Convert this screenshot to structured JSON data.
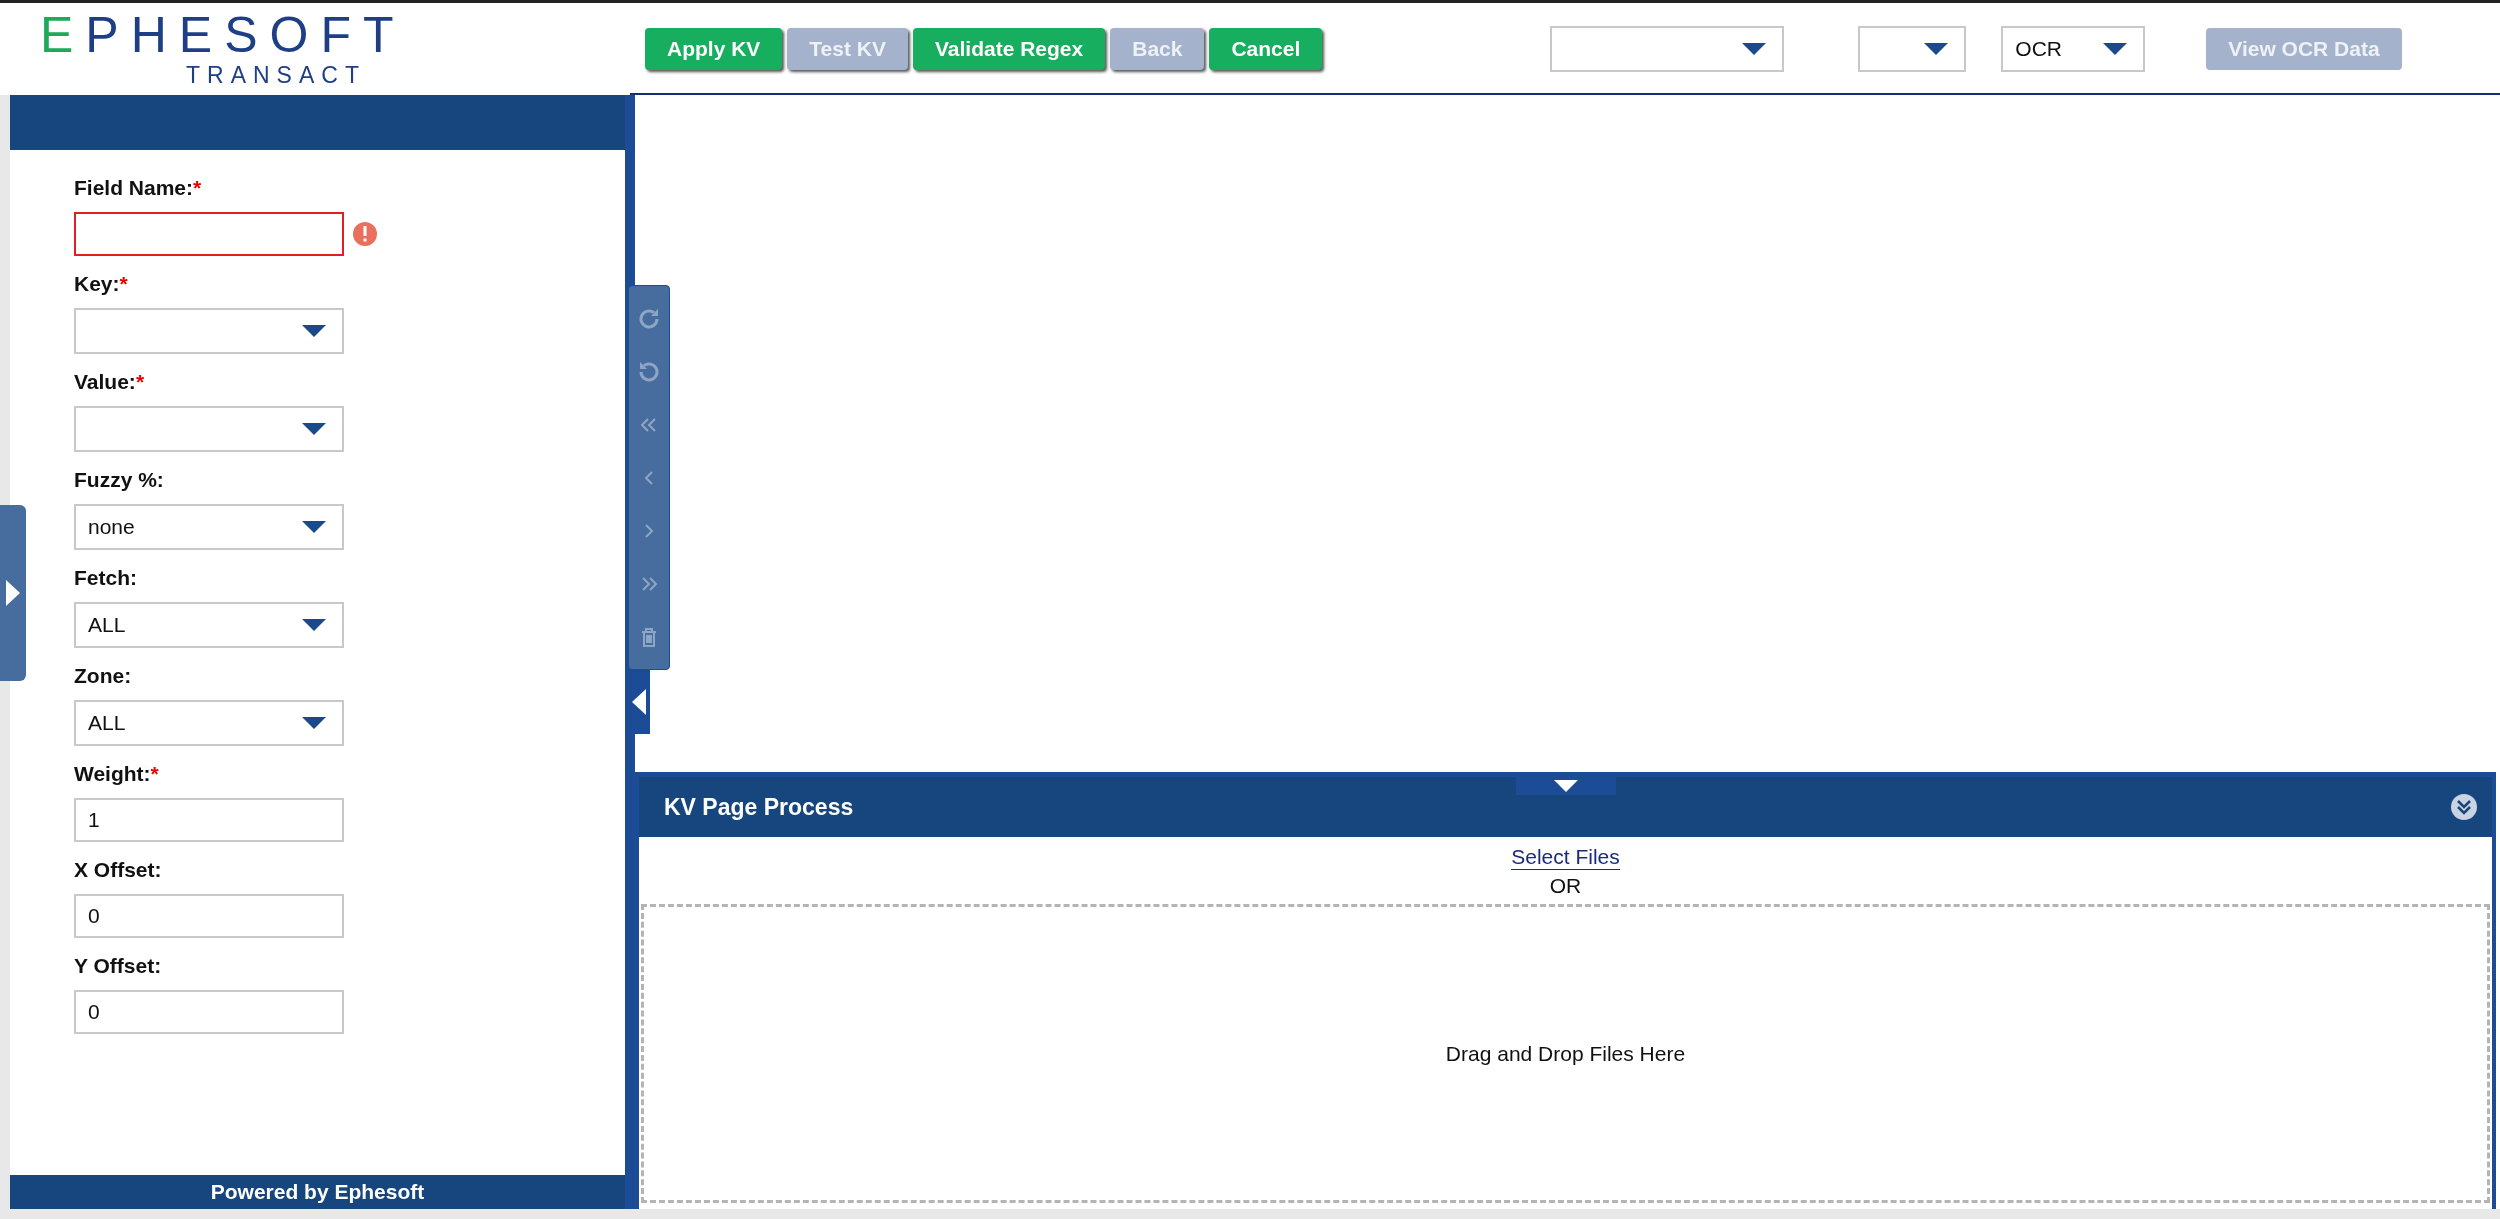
{
  "header": {
    "logo": {
      "title": "EPHESOFT",
      "subtitle": "TRANSACT"
    },
    "buttons": [
      {
        "label": "Apply KV",
        "disabled": false
      },
      {
        "label": "Test KV",
        "disabled": true
      },
      {
        "label": "Validate Regex",
        "disabled": false
      },
      {
        "label": "Back",
        "disabled": true
      },
      {
        "label": "Cancel",
        "disabled": false
      }
    ],
    "selects": [
      {
        "kind": "wide"
      },
      {
        "kind": "narrow"
      },
      {
        "kind": "medium",
        "value": "OCR"
      }
    ],
    "view_button": {
      "label": "View OCR Data",
      "disabled": true
    }
  },
  "form": {
    "fields": [
      {
        "label": "Field Name:",
        "required_mark": "*",
        "kind": "text",
        "error": true
      },
      {
        "label": "Key:",
        "required_mark": "*",
        "kind": "dropdown"
      },
      {
        "label": "Value:",
        "required_mark": "*",
        "kind": "dropdown"
      },
      {
        "label": "Fuzzy %:",
        "kind": "dropdown",
        "value": "none"
      },
      {
        "label": "Fetch:",
        "kind": "dropdown",
        "value": "ALL"
      },
      {
        "label": "Zone:",
        "kind": "dropdown",
        "value": "ALL"
      },
      {
        "label": "Weight:",
        "required_mark": "*",
        "kind": "text",
        "value": "1"
      },
      {
        "label": "X Offset:",
        "kind": "text",
        "value": "0"
      },
      {
        "label": "Y Offset:",
        "kind": "text",
        "value": "0"
      }
    ],
    "footer": "Powered by Ephesoft"
  },
  "upload": {
    "title": "KV Page Process",
    "link": "Select Files",
    "separator": "OR",
    "dropzone": "Drag and Drop Files Here"
  }
}
